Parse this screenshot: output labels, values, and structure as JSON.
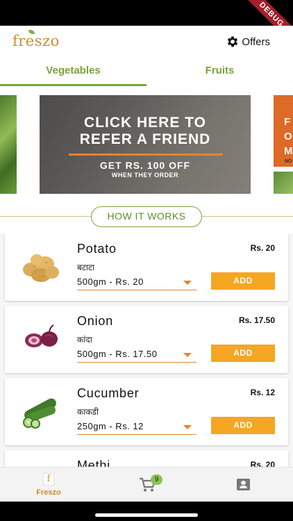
{
  "status_bar": {
    "debug_label": "DEBUG"
  },
  "header": {
    "logo": "freszo",
    "offers_label": "Offers",
    "offers_icon": "gear-icon"
  },
  "tabs": [
    {
      "label": "Vegetables",
      "active": true
    },
    {
      "label": "Fruits",
      "active": false
    }
  ],
  "banner": {
    "line1": "CLICK HERE TO",
    "line2": "REFER A FRIEND",
    "sub1": "GET RS. 100 OFF",
    "sub2": "WHEN THEY ORDER",
    "next_slide_text": "F\nO\nM",
    "next_slide_small": "NO",
    "accent_color": "#e8832c"
  },
  "how_it_works": {
    "label": "HOW IT WORKS"
  },
  "products": [
    {
      "name": "Potato",
      "local_name": "बटाटा",
      "selected_option": "500gm - Rs. 20",
      "price": "Rs. 20",
      "add_label": "ADD",
      "icon": "potato-icon"
    },
    {
      "name": "Onion",
      "local_name": "कांदा",
      "selected_option": "500gm - Rs. 17.50",
      "price": "Rs. 17.50",
      "add_label": "ADD",
      "icon": "onion-icon"
    },
    {
      "name": "Cucumber",
      "local_name": "काकडी",
      "selected_option": "250gm - Rs. 12",
      "price": "Rs. 12",
      "add_label": "ADD",
      "icon": "cucumber-icon"
    },
    {
      "name": "Methi",
      "price": "Rs. 20"
    }
  ],
  "bottom_nav": {
    "home_label": "Freszo",
    "home_icon_text": "f",
    "cart_count": "9"
  },
  "colors": {
    "brand_green": "#7aa33a",
    "brand_orange": "#d08a2c",
    "add_button": "#f5a623"
  }
}
